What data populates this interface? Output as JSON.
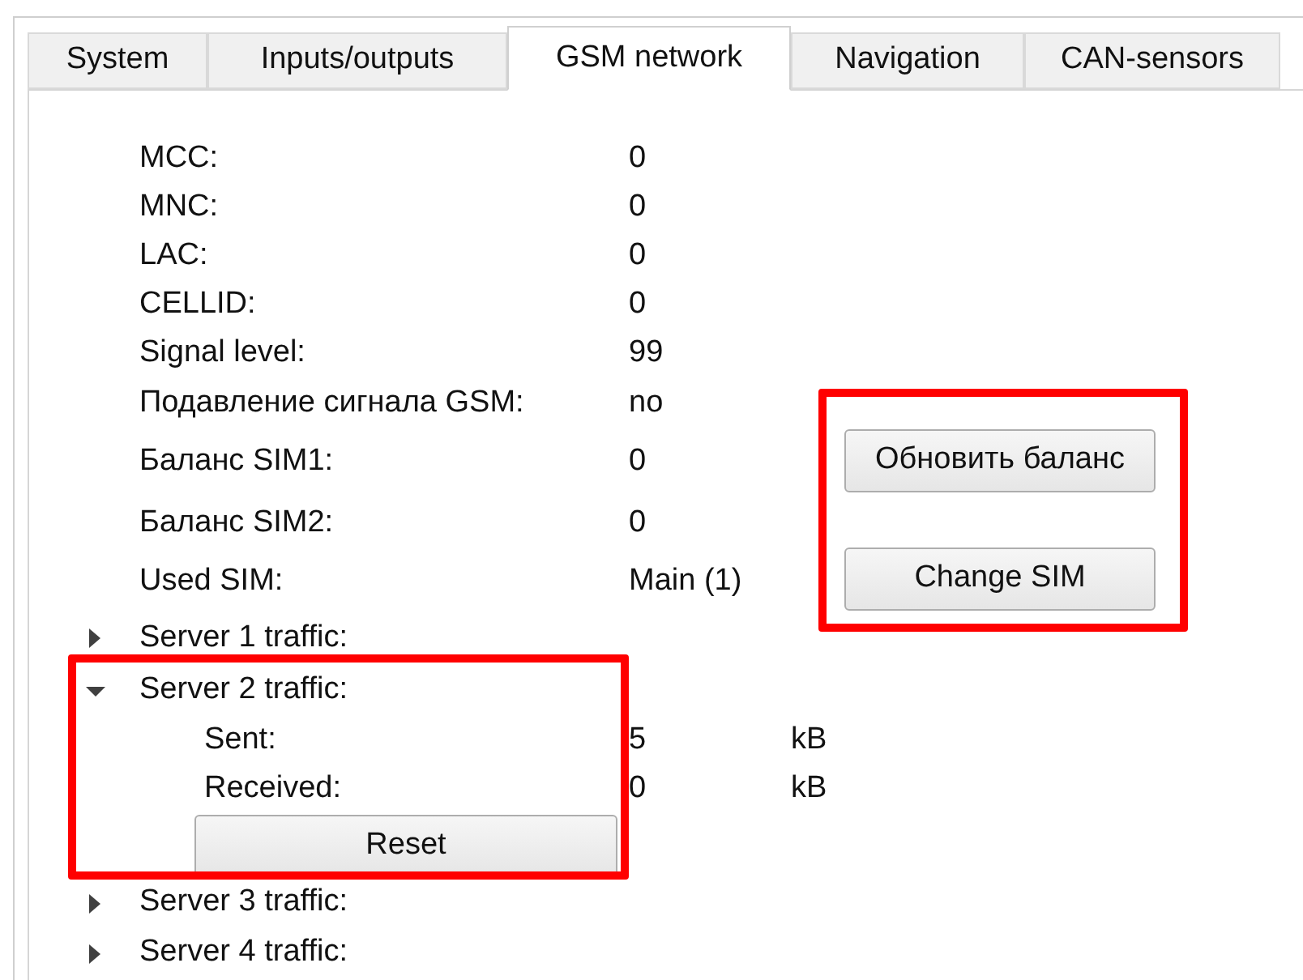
{
  "tabs": [
    {
      "label": "System",
      "selected": false
    },
    {
      "label": "Inputs/outputs",
      "selected": false
    },
    {
      "label": "GSM network",
      "selected": true
    },
    {
      "label": "Navigation",
      "selected": false
    },
    {
      "label": "CAN-sensors",
      "selected": false
    }
  ],
  "fields": [
    {
      "label": "MCC:",
      "value": "0"
    },
    {
      "label": "MNC:",
      "value": "0"
    },
    {
      "label": "LAC:",
      "value": "0"
    },
    {
      "label": "CELLID:",
      "value": "0"
    },
    {
      "label": "Signal level:",
      "value": "99"
    },
    {
      "label": "Подавление сигнала GSM:",
      "value": "no"
    },
    {
      "label": "Баланс SIM1:",
      "value": "0"
    },
    {
      "label": "Баланс SIM2:",
      "value": "0"
    },
    {
      "label": "Used SIM:",
      "value": "Main (1)"
    }
  ],
  "actions": [
    {
      "label": "Обновить баланс"
    },
    {
      "label": "Change SIM"
    }
  ],
  "servers": [
    {
      "label": "Server 1 traffic:",
      "expanded": false
    },
    {
      "label": "Server 2 traffic:",
      "expanded": true,
      "rows": [
        {
          "label": "Sent:",
          "value": "5",
          "unit": "kB"
        },
        {
          "label": "Received:",
          "value": "0",
          "unit": "kB"
        }
      ],
      "button": "Reset"
    },
    {
      "label": "Server 3 traffic:",
      "expanded": false
    },
    {
      "label": "Server 4 traffic:",
      "expanded": false
    }
  ]
}
